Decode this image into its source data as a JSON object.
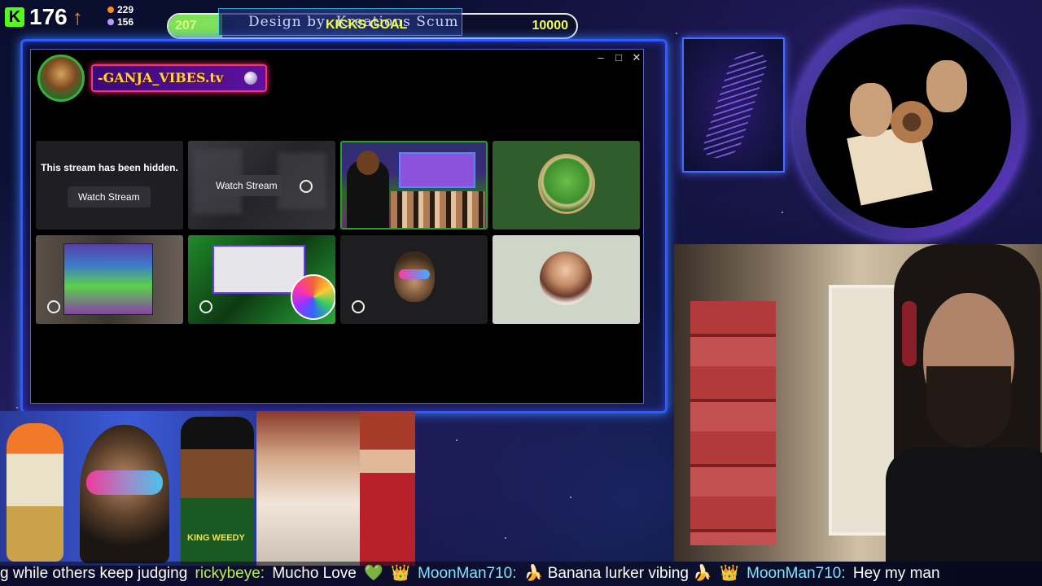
{
  "stats": {
    "kick_count": "176",
    "stat_a": "229",
    "stat_b": "156"
  },
  "goal": {
    "current": "207",
    "label": "KICKS GOAL",
    "target": "10000",
    "progress": 0.0207,
    "design_text": "Design by: Kreations Scum"
  },
  "window": {
    "minimize": "–",
    "maximize": "□",
    "close": "✕",
    "channel_name": "-GANJA_VIBES.tv"
  },
  "tiles": {
    "hidden_message": "This stream has been hidden.",
    "watch_stream_1": "Watch Stream",
    "watch_stream_2": "Watch Stream"
  },
  "overlay": {
    "rapper_caption": "KING WEEDY"
  },
  "ticker": {
    "msg1": "g while others keep judging",
    "user1": "rickybeye:",
    "msg2": "Mucho Love",
    "heart": "💚",
    "crown1": "👑",
    "user2": "MoonMan710:",
    "msg3": "🍌 Banana lurker vibing 🍌",
    "crown2": "👑",
    "user3": "MoonMan710:",
    "msg4": "Hey my man"
  },
  "colors": {
    "accent": "#2b5cff",
    "kick_green": "#53fc18",
    "goal_label": "#f4ff3a"
  }
}
